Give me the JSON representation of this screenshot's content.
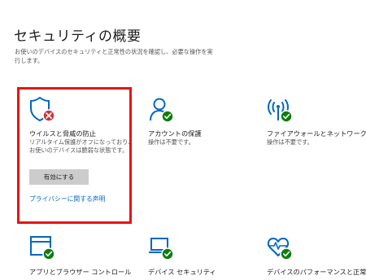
{
  "header": {
    "title": "セキュリティの概要",
    "description": "お使いのデバイスのセキュリティと正常性の状況を確認し、必要な操作を実行します。"
  },
  "cards": {
    "virus": {
      "title": "ウイルスと脅威の防止",
      "status_line1": "リアルタイム保護がオフになっており、",
      "status_line2": "お使いのデバイスは脆弱な状態です。",
      "action_label": "有効にする",
      "link_label": "プライバシーに関する声明",
      "icon": "shield-icon",
      "status_icon": "error-icon"
    },
    "account": {
      "title": "アカウントの保護",
      "status": "操作は不要です。",
      "icon": "person-icon",
      "status_icon": "check-icon"
    },
    "firewall": {
      "title": "ファイアウォールとネットワーク保護",
      "status": "操作は不要です。",
      "icon": "antenna-icon",
      "status_icon": "check-icon"
    },
    "app_browser": {
      "title": "アプリとブラウザー コントロール",
      "icon": "browser-window-icon",
      "status_icon": "check-icon"
    },
    "device_security": {
      "title": "デバイス セキュリティ",
      "icon": "laptop-icon",
      "status_icon": "check-icon"
    },
    "performance": {
      "title": "デバイスのパフォーマンスと正常性",
      "icon": "heart-pulse-icon",
      "status_icon": "check-icon"
    }
  },
  "colors": {
    "accent": "#0067c0",
    "ok": "#107c10",
    "error": "#d13438",
    "highlight": "#e51414",
    "button_bg": "#cccccc"
  }
}
